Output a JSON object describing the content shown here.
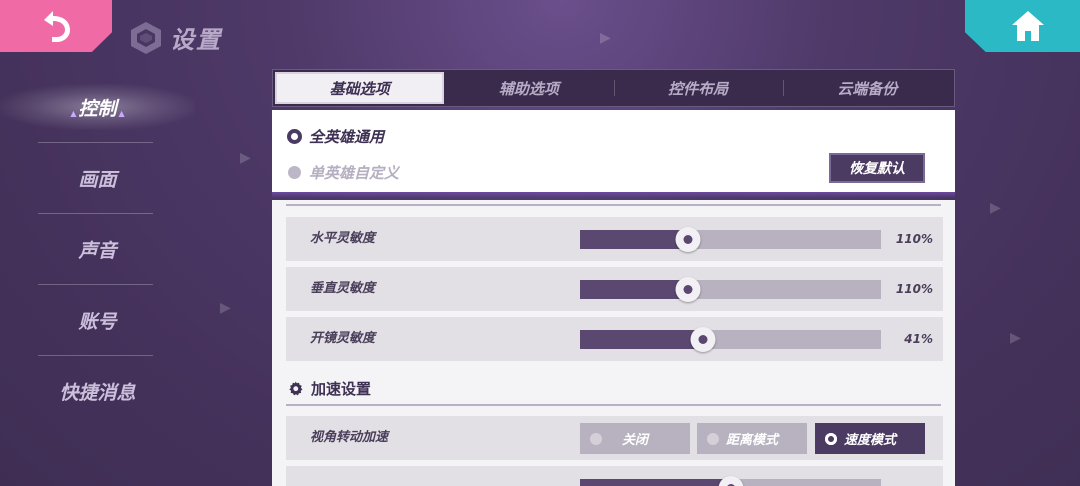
{
  "header": {
    "title": "设置",
    "back_icon": "back-arrow-icon",
    "home_icon": "home-icon",
    "back_color": "#f06aa6",
    "home_color": "#2bb9c6"
  },
  "sidebar": {
    "items": [
      {
        "label": "控制",
        "active": true
      },
      {
        "label": "画面",
        "active": false
      },
      {
        "label": "声音",
        "active": false
      },
      {
        "label": "账号",
        "active": false
      },
      {
        "label": "快捷消息",
        "active": false
      }
    ]
  },
  "tabs": [
    {
      "label": "基础选项",
      "active": true
    },
    {
      "label": "辅助选项",
      "active": false
    },
    {
      "label": "控件布局",
      "active": false
    },
    {
      "label": "云端备份",
      "active": false
    }
  ],
  "mode": {
    "option_all": "全英雄通用",
    "option_single": "单英雄自定义",
    "selected": "全英雄通用",
    "reset_label": "恢复默认"
  },
  "sliders": [
    {
      "label": "水平灵敏度",
      "value_text": "110%",
      "fraction": 0.36
    },
    {
      "label": "垂直灵敏度",
      "value_text": "110%",
      "fraction": 0.36
    },
    {
      "label": "开镜灵敏度",
      "value_text": "41%",
      "fraction": 0.41
    }
  ],
  "accel_section": {
    "title": "加速设置",
    "icon": "gear-icon",
    "view_accel": {
      "label": "视角转动加速",
      "options": [
        "关闭",
        "距离模式",
        "速度模式"
      ],
      "selected": "速度模式"
    }
  },
  "colors": {
    "accent_purple": "#4b3a62",
    "panel_bg": "#f4f3f6"
  }
}
